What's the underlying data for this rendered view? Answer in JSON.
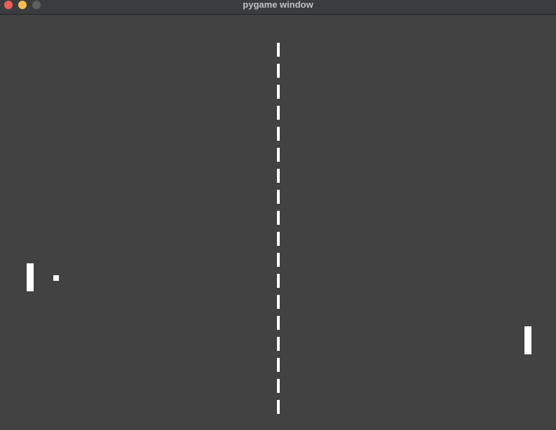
{
  "window": {
    "title": "pygame window",
    "controls": {
      "close_color": "#ee5f57",
      "minimize_color": "#f5bd4f",
      "maximize_color": "#5f5f5f"
    }
  },
  "game": {
    "background_color": "#424242",
    "foreground_color": "#ffffff",
    "net_dash_count": 18
  }
}
